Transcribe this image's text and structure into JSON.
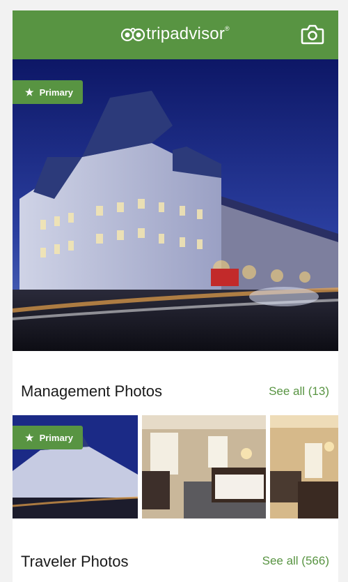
{
  "header": {
    "logo_text": "tripadvisor",
    "logo_mark": "®",
    "camera_icon": "camera-icon"
  },
  "hero": {
    "badge_label": "Primary",
    "badge_icon": "star-icon"
  },
  "management": {
    "title": "Management Photos",
    "see_all": "See all (13)",
    "thumb_badge": "Primary"
  },
  "traveler": {
    "title": "Traveler Photos",
    "see_all": "See all (566)"
  },
  "colors": {
    "brand_green": "#589442",
    "sky": "#1b2a86"
  }
}
